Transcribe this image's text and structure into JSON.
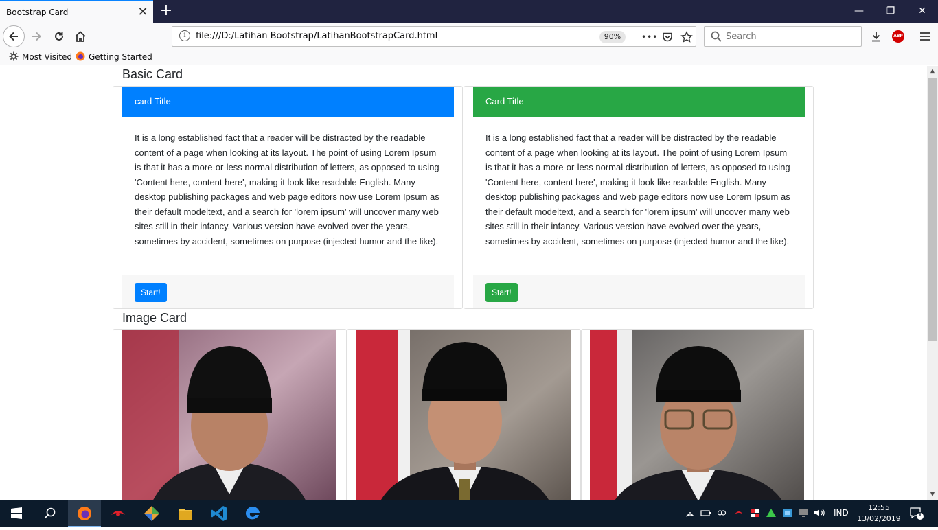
{
  "browser": {
    "tab_title": "Bootstrap Card",
    "tab_close": "✕",
    "new_tab": "+",
    "window_minimize": "—",
    "window_restore": "❐",
    "window_close": "✕",
    "url": "file:///D:/Latihan Bootstrap/LatihanBootstrapCard.html",
    "zoom": "90%",
    "more_actions": "•••",
    "search_placeholder": "Search",
    "bookmarks": [
      "Most Visited",
      "Getting Started"
    ],
    "abp_label": "ABP"
  },
  "page": {
    "basic_card_title": "Basic Card",
    "image_card_title": "Image Card",
    "cards": [
      {
        "header": "card Title",
        "header_color": "#0080ff",
        "body": "It is a long established fact that a reader will be distracted by the readable content of a page when looking at its layout. The point of using Lorem Ipsum is that it has a more-or-less normal distribution of letters, as opposed to using 'Content here, content here', making it look like readable English. Many desktop publishing packages and web page editors now use Lorem Ipsum as their default modeltext, and a search for 'lorem ipsum' will uncover many web sites still in their infancy. Various version have evolved over the years, sometimes by accident, sometimes on purpose (injected humor and the like).",
        "button": "Start!",
        "button_color": "#0080ff"
      },
      {
        "header": "Card Title",
        "header_color": "#28a745",
        "body": "It is a long established fact that a reader will be distracted by the readable content of a page when looking at its layout. The point of using Lorem Ipsum is that it has a more-or-less normal distribution of letters, as opposed to using 'Content here, content here', making it look like readable English. Many desktop publishing packages and web page editors now use Lorem Ipsum as their default modeltext, and a search for 'lorem ipsum' will uncover many web sites still in their infancy. Various version have evolved over the years, sometimes by accident, sometimes on purpose (injected humor and the like).",
        "button": "Start!",
        "button_color": "#28a745"
      }
    ]
  },
  "taskbar": {
    "language": "IND",
    "time": "12:55",
    "date": "13/02/2019",
    "notification_count": "1"
  }
}
